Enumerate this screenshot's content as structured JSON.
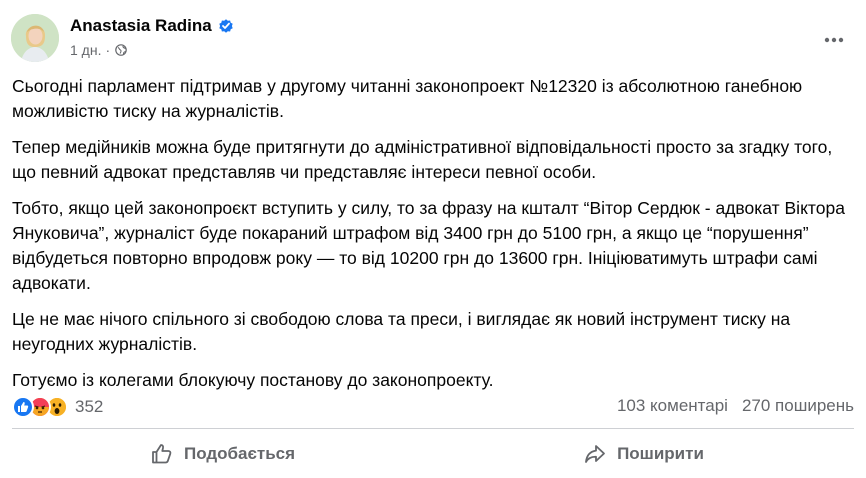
{
  "post": {
    "author": "Anastasia Radina",
    "time": "1 дн.",
    "paragraphs": [
      "Сьогодні парламент підтримав у другому читанні  законопроект №12320 із абсолютною ганебною можливістю тиску на журналістів.",
      "Тепер медійників можна буде притягнути до адміністративної відповідальності просто за згадку того, що певний адвокат представляв чи представляє інтереси певної особи.",
      "Тобто, якщо цей законопроєкт вступить у силу, то за фразу на кшталт “Вітор Сердюк - адвокат Віктора Януковича”, журналіст буде покараний штрафом від 3400 грн до 5100 грн, а якщо це “порушення” відбудеться повторно впродовж року — то від 10200 грн до 13600 грн. Ініціюватимуть штрафи самі адвокати.",
      "Це не має нічого спільного зі свободою слова та преси, і виглядає як новий інструмент тиску на неугодних журналістів.",
      "Готуємо із колегами блокуючу постанову до законопроекту."
    ],
    "reactions": {
      "icons": [
        "like-icon",
        "angry-icon",
        "wow-icon"
      ],
      "count": "352"
    },
    "comments": "103 коментарі",
    "shares": "270 поширень"
  },
  "actions": {
    "like_label": "Подобається",
    "share_label": "Поширити"
  },
  "colors": {
    "accent": "#1877f2",
    "muted": "#65676b",
    "divider": "#ced0d4",
    "angry": "#f33e58",
    "wow": "#f7b125"
  }
}
